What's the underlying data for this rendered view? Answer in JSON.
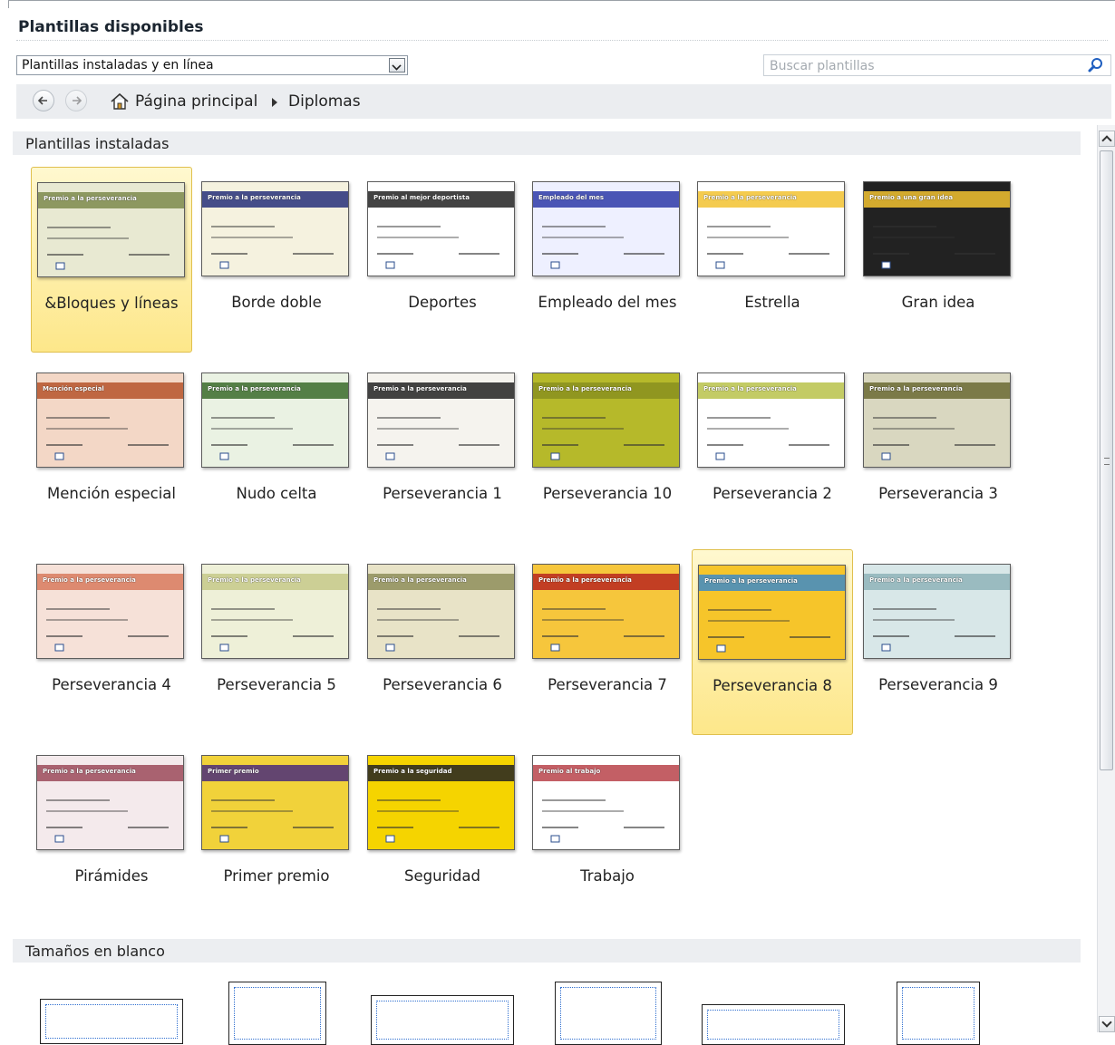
{
  "header": {
    "title": "Plantillas disponibles"
  },
  "source_select": {
    "value": "Plantillas instaladas y en línea"
  },
  "search": {
    "placeholder": "Buscar plantillas"
  },
  "breadcrumb": {
    "home": "Página principal",
    "current": "Diplomas"
  },
  "sections": {
    "installed": "Plantillas instaladas",
    "blank": "Tamaños en blanco"
  },
  "templates": [
    {
      "label": "&Bloques y líneas",
      "selected": true,
      "headline": "Premio a la perseverancia"
    },
    {
      "label": "Borde doble",
      "headline": "Premio a la perseverancia"
    },
    {
      "label": "Deportes",
      "headline": "Premio al mejor deportista"
    },
    {
      "label": "Empleado del mes",
      "headline": "Empleado del mes"
    },
    {
      "label": "Estrella",
      "headline": "Premio a la perseverancia"
    },
    {
      "label": "Gran idea",
      "headline": "Premio a una gran idea"
    },
    {
      "label": "Mención especial",
      "headline": "Mención especial"
    },
    {
      "label": "Nudo celta",
      "headline": "Premio a la perseverancia"
    },
    {
      "label": "Perseverancia  1",
      "headline": "Premio a la perseverancia"
    },
    {
      "label": "Perseverancia  10",
      "headline": "Premio a la perseverancia"
    },
    {
      "label": "Perseverancia  2",
      "headline": "Premio a la perseverancia"
    },
    {
      "label": "Perseverancia  3",
      "headline": "Premio a la perseverancia"
    },
    {
      "label": "Perseverancia  4",
      "headline": "Premio a la perseverancia"
    },
    {
      "label": "Perseverancia  5",
      "headline": "Premio a la perseverancia"
    },
    {
      "label": "Perseverancia  6",
      "headline": "Premio a la perseverancia"
    },
    {
      "label": "Perseverancia  7",
      "headline": "Premio a la perseverancia"
    },
    {
      "label": "Perseverancia  8",
      "selected": true,
      "headline": "Premio a la perseverancia"
    },
    {
      "label": "Perseverancia  9",
      "headline": "Premio a la perseverancia"
    },
    {
      "label": "Pirámides",
      "headline": "Premio a la perseverancia"
    },
    {
      "label": "Primer premio",
      "headline": "Primer premio"
    },
    {
      "label": "Seguridad",
      "headline": "Premio a la seguridad"
    },
    {
      "label": "Trabajo",
      "headline": "Premio al trabajo"
    }
  ],
  "colors": {
    "selection": "#fde78a",
    "selection_border": "#e0c04e",
    "section_bg": "#eceef1",
    "accent_blue": "#1f5fc0"
  }
}
